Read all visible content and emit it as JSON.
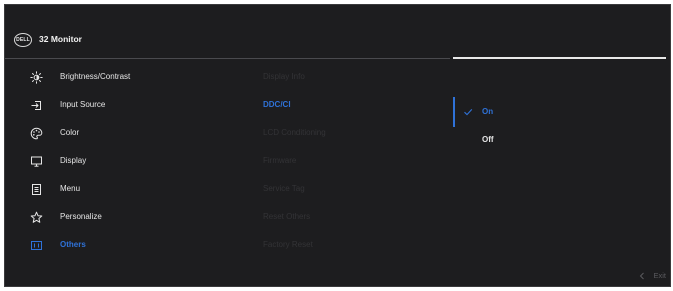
{
  "header": {
    "logo_text": "DELL",
    "title": "32 Monitor"
  },
  "menu": {
    "items": [
      {
        "label": "Brightness/Contrast",
        "icon": "brightness-icon"
      },
      {
        "label": "Input Source",
        "icon": "input-source-icon"
      },
      {
        "label": "Color",
        "icon": "color-palette-icon"
      },
      {
        "label": "Display",
        "icon": "display-icon"
      },
      {
        "label": "Menu",
        "icon": "menu-icon"
      },
      {
        "label": "Personalize",
        "icon": "star-icon"
      },
      {
        "label": "Others",
        "icon": "others-icon",
        "active": true
      }
    ]
  },
  "submenu": {
    "items": [
      {
        "label": "Display Info"
      },
      {
        "label": "DDC/CI",
        "active": true
      },
      {
        "label": "LCD Conditioning"
      },
      {
        "label": "Firmware"
      },
      {
        "label": "Service Tag"
      },
      {
        "label": "Reset Others"
      },
      {
        "label": "Factory Reset"
      }
    ]
  },
  "options": {
    "items": [
      {
        "label": "On",
        "selected": true
      },
      {
        "label": "Off",
        "selected": false
      }
    ]
  },
  "footer": {
    "exit_label": "Exit",
    "back_icon": "chevron-left-icon"
  },
  "colors": {
    "background": "#1d1d1f",
    "accent": "#2f72d8",
    "text": "#e6e6e6",
    "disabled_text": "#333336"
  }
}
